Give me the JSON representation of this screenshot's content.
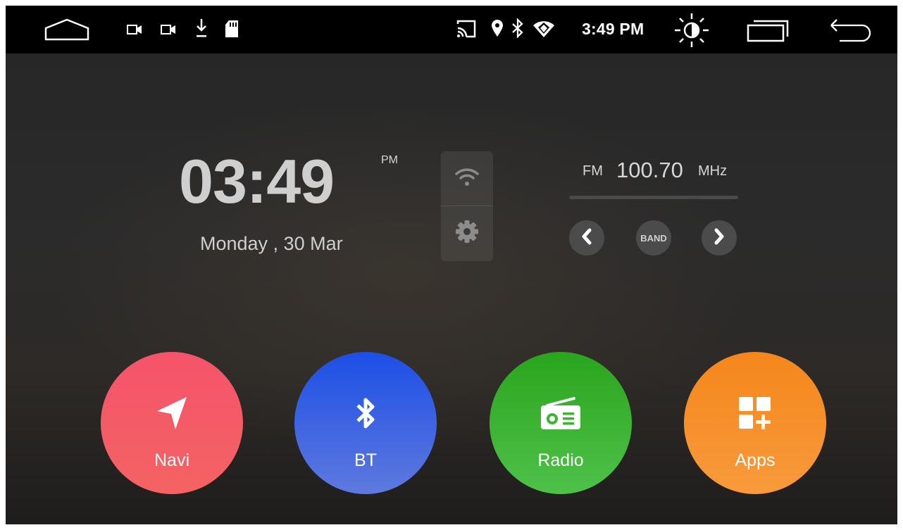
{
  "status_bar": {
    "time": "3:49 PM",
    "icons": [
      "home-icon",
      "video-icon",
      "video-icon",
      "download-icon",
      "sd-card-icon",
      "cast-icon",
      "location-icon",
      "bluetooth-icon",
      "wifi-icon",
      "brightness-icon",
      "recents-icon",
      "back-icon"
    ]
  },
  "clock": {
    "time": "03:49",
    "ampm": "PM",
    "date": "Monday , 30 Mar"
  },
  "quick_panel": {
    "icons": [
      "wifi-icon",
      "settings-gear-icon"
    ]
  },
  "radio": {
    "band": "FM",
    "frequency": "100.70",
    "unit": "MHz",
    "band_button_label": "BAND"
  },
  "dock": [
    {
      "label": "Navi",
      "icon": "navigation-arrow-icon",
      "color": "#f4566a"
    },
    {
      "label": "BT",
      "icon": "bluetooth-icon",
      "color": "#2f5fe3"
    },
    {
      "label": "Radio",
      "icon": "radio-icon",
      "color": "#35b02a"
    },
    {
      "label": "Apps",
      "icon": "apps-grid-icon",
      "color": "#f68d2a"
    }
  ]
}
